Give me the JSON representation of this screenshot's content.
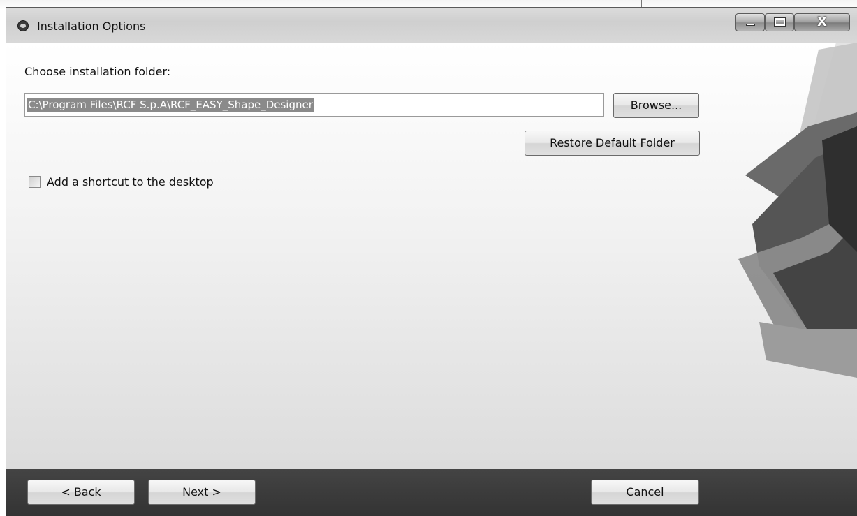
{
  "window": {
    "title": "Installation Options",
    "minimize_label": "minimize",
    "maximize_label": "maximize",
    "close_label": "X"
  },
  "main": {
    "folder_label": "Choose installation folder:",
    "folder_path": "C:\\Program Files\\RCF S.p.A\\RCF_EASY_Shape_Designer",
    "browse_label": "Browse...",
    "restore_label": "Restore Default Folder",
    "shortcut_label": "Add a shortcut to the desktop",
    "shortcut_checked": false
  },
  "footer": {
    "back_label": "< Back",
    "next_label": "Next >",
    "cancel_label": "Cancel"
  },
  "colors": {
    "footer_bg": "#3a3a3a",
    "selection_bg": "#8a8a8a"
  }
}
